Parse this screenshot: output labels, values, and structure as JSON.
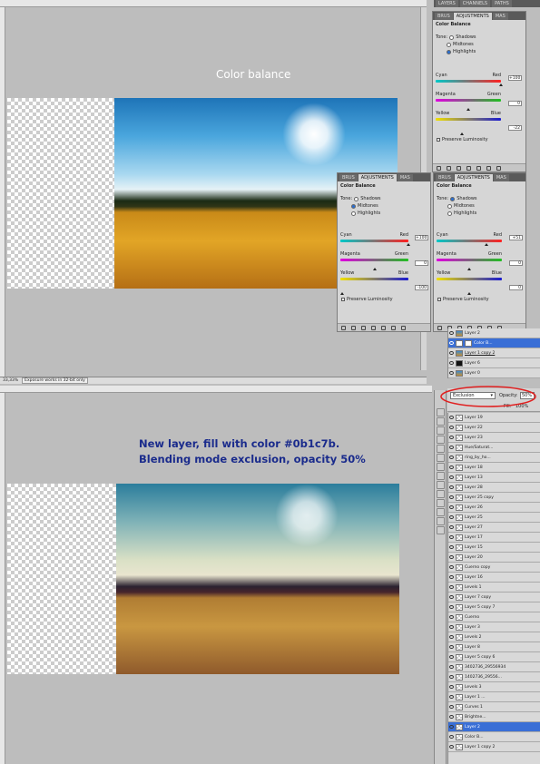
{
  "top": {
    "caption": "Color balance",
    "status": {
      "zoom": "33,33%",
      "message": "Exposure works in 32-bit only"
    },
    "panel_tabs": [
      "BRUS",
      "ADJUSTMENTS",
      "MAS"
    ],
    "layers_tabs": [
      "LAYERS",
      "CHANNELS",
      "PATHS"
    ],
    "highlights_panel": {
      "title": "Color Balance",
      "tone_label": "Tone:",
      "tones": [
        "Shadows",
        "Midtones",
        "Highlights"
      ],
      "selected": "Highlights",
      "cyan": "Cyan",
      "red": "Red",
      "magenta": "Magenta",
      "green": "Green",
      "yellow": "Yellow",
      "blue": "Blue",
      "values": [
        "+100",
        "0",
        "-22"
      ],
      "positions": [
        1.0,
        0.5,
        0.39
      ],
      "preserve": "Preserve Luminosity"
    },
    "shadows_panel": {
      "title": "Color Balance",
      "tone_label": "Tone:",
      "tones": [
        "Shadows",
        "Midtones",
        "Highlights"
      ],
      "selected": "Midtones",
      "cyan": "Cyan",
      "red": "Red",
      "magenta": "Magenta",
      "green": "Green",
      "yellow": "Yellow",
      "blue": "Blue",
      "values": [
        "+100",
        "0",
        "-100"
      ],
      "positions": [
        1.0,
        0.5,
        0.0
      ],
      "preserve": "Preserve Luminosity"
    },
    "midtones_panel": {
      "title": "Color Balance",
      "tone_label": "Tone:",
      "tones": [
        "Shadows",
        "Midtones",
        "Highlights"
      ],
      "selected": "Shadows",
      "cyan": "Cyan",
      "red": "Red",
      "magenta": "Magenta",
      "green": "Green",
      "yellow": "Yellow",
      "blue": "Blue",
      "values": [
        "+51",
        "0",
        "0"
      ],
      "positions": [
        0.75,
        0.5,
        0.5
      ],
      "preserve": "Preserve Luminosity"
    },
    "layers": [
      "Layer 2",
      "Color B...",
      "Layer 1 copy 2",
      "Layer 6",
      "Layer 0"
    ],
    "selected_layer": "Color B..."
  },
  "bottom": {
    "annotation_line1": "New layer, fill with color #0b1c7b.",
    "annotation_line2": "Blending mode exclusion, opacity 50%",
    "blend_mode": "Exclusion",
    "opacity_label": "Opacity:",
    "opacity_value": "50%",
    "fill_label": "Fill:",
    "fill_value": "100%",
    "layers": [
      "Layer 19",
      "Layer 22",
      "Layer 23",
      "Hue/Saturat...",
      "ring_by_ho...",
      "Layer 18",
      "Layer 13",
      "Layer 28",
      "Layer 25 copy",
      "Layer 26",
      "Layer 25",
      "Layer 27",
      "Layer 17",
      "Layer 15",
      "Layer 20",
      "Cuerno copy",
      "Layer 16",
      "Levels 1",
      "Layer 7 copy",
      "Layer 5 copy 7",
      "Cuerno",
      "Layer 3",
      "Levels 2",
      "Layer 8",
      "Layer 5 copy 6",
      "3402736_29556934",
      "1402736_29556...",
      "Levels 3",
      "Layer 1 ...",
      "Curves 1",
      "Brightne...",
      "Layer 2",
      "Color B...",
      "Layer 1 copy 2"
    ],
    "selected_layer": "Layer 2",
    "highlight_color": "#e02020"
  }
}
